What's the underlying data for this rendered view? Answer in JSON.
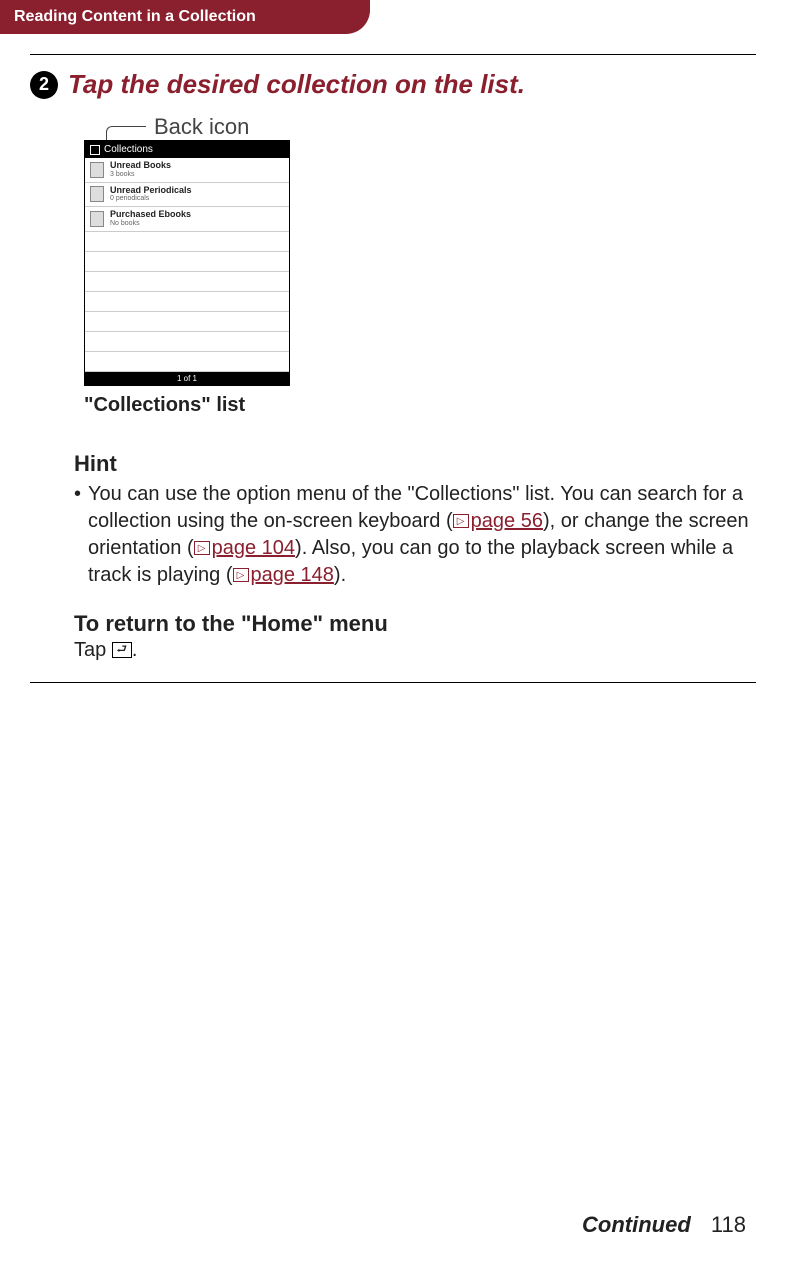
{
  "header": {
    "title": "Reading Content in a Collection"
  },
  "step": {
    "number": "2",
    "title": "Tap the desired collection on the list."
  },
  "backIconLabel": "Back icon",
  "screenshot": {
    "headerTitle": "Collections",
    "items": [
      {
        "title": "Unread Books",
        "sub": "3 books"
      },
      {
        "title": "Unread Periodicals",
        "sub": "0 periodicals"
      },
      {
        "title": "Purchased Ebooks",
        "sub": "No books"
      }
    ],
    "footer": "1 of 1"
  },
  "caption": "\"Collections\" list",
  "hint": {
    "title": "Hint",
    "textParts": {
      "p1": "You can use the option menu of the \"Collections\" list. You can search for a collection using the on-screen keyboard (",
      "link1": "page 56",
      "p2": "), or change the screen orientation (",
      "link2": "page 104",
      "p3": "). Also, you can go to the playback screen while a track is playing (",
      "link3": "page 148",
      "p4": ")."
    }
  },
  "returnSection": {
    "title": "To return to the \"Home\" menu",
    "bodyPrefix": "Tap ",
    "bodySuffix": "."
  },
  "footer": {
    "continued": "Continued",
    "page": "118"
  }
}
